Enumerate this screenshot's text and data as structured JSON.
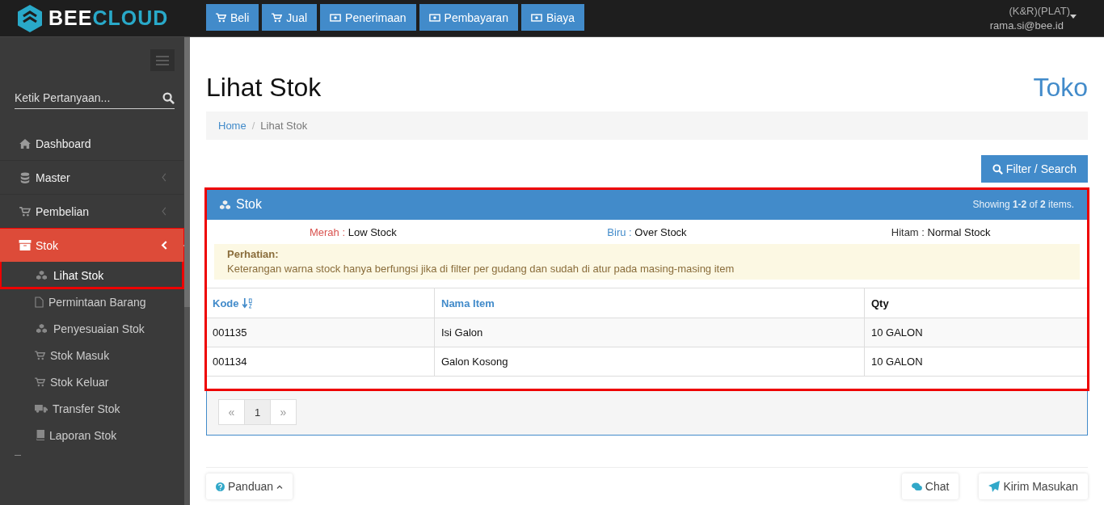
{
  "brand": {
    "name_part_1": "BEE",
    "name_part_2": "CLOUD"
  },
  "top_nav": [
    {
      "label": "Beli"
    },
    {
      "label": "Jual"
    },
    {
      "label": "Penerimaan"
    },
    {
      "label": "Pembayaran"
    },
    {
      "label": "Biaya"
    }
  ],
  "user": {
    "company": "(K&R)(PLAT)",
    "email": "rama.si@bee.id"
  },
  "sidebar": {
    "search": {
      "placeholder": "Ketik Pertanyaan..."
    },
    "items": [
      {
        "label": "Dashboard",
        "selected": false,
        "has_submenu": false,
        "expanded": false
      },
      {
        "label": "Master",
        "selected": false,
        "has_submenu": true,
        "expanded": false
      },
      {
        "label": "Pembelian",
        "selected": false,
        "has_submenu": true,
        "expanded": false
      },
      {
        "label": "Stok",
        "selected": true,
        "has_submenu": true,
        "expanded": true,
        "highlighted": true,
        "children": [
          {
            "label": "Lihat Stok",
            "selected": true
          },
          {
            "label": "Permintaan Barang",
            "selected": false
          },
          {
            "label": "Penyesuaian Stok",
            "selected": false
          },
          {
            "label": "Stok Masuk",
            "selected": false
          },
          {
            "label": "Stok Keluar",
            "selected": false
          },
          {
            "label": "Transfer Stok",
            "selected": false
          },
          {
            "label": "Laporan Stok",
            "selected": false
          }
        ]
      }
    ]
  },
  "page": {
    "title": "Lihat Stok",
    "store": "Toko"
  },
  "breadcrumb": {
    "items": [
      "Home",
      "Lihat Stok"
    ],
    "separator": "/"
  },
  "filter_button": "Filter / Search",
  "panel": {
    "title": "Stok",
    "highlighted": true,
    "summary": "Showing **1-2** of **2** items.",
    "legend": [
      {
        "color_name": "Merah :",
        "meaning": "Low Stock",
        "color": "#d9534f"
      },
      {
        "color_name": "Biru :",
        "meaning": "Over Stock",
        "color": "#428bca"
      },
      {
        "color_name": "Hitam :",
        "meaning": "Normal Stock",
        "color": "#333333"
      }
    ],
    "notice": {
      "title": "Perhatian:",
      "text": "Keterangan warna stock hanya berfungsi jika di filter per gudang dan sudah di atur pada masing-masing item"
    },
    "table": {
      "columns": [
        {
          "label": "Kode",
          "sortable": true,
          "link": true
        },
        {
          "label": "Nama Item",
          "sortable": false,
          "link": true
        },
        {
          "label": "Qty",
          "sortable": false,
          "link": false
        }
      ],
      "rows": [
        [
          "001135",
          "Isi Galon",
          "10 GALON"
        ],
        [
          "001134",
          "Galon Kosong",
          "10 GALON"
        ]
      ]
    },
    "pagination": [
      {
        "label": "«",
        "kind": "prev",
        "selected": false
      },
      {
        "label": "1",
        "kind": "page",
        "selected": true
      },
      {
        "label": "»",
        "kind": "next",
        "selected": false
      }
    ]
  },
  "footer": {
    "guide": "Panduan",
    "chat": "Chat",
    "feedback": "Kirim Masukan"
  }
}
